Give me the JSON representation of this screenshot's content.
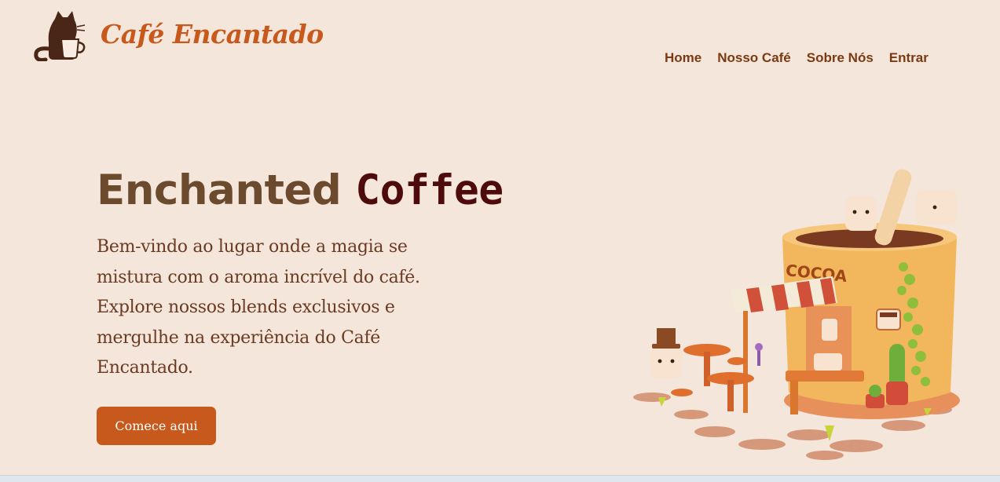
{
  "header": {
    "brand": "Café Encantado",
    "logo_icon": "cat-with-coffee-cup-icon"
  },
  "nav": {
    "items": [
      "Home",
      "Nosso Café",
      "Sobre Nós",
      "Entrar"
    ]
  },
  "hero": {
    "title_part1": "Enchanted",
    "title_part2": "Coffee",
    "description": "Bem-vindo ao lugar onde a magia se mistura com o aroma incrível do café. Explore nossos blends exclusivos e mergulhe na experiência do Café Encantado.",
    "cta_label": "Comece aqui",
    "illustration_sign": "COCOA",
    "illustration_icon": "coffee-shop-cup-illustration"
  },
  "colors": {
    "background": "#f5e6db",
    "brand": "#c8591c",
    "nav": "#7b3a12",
    "title_primary": "#6b4a2e",
    "title_accent": "#4e0b0b",
    "body_text": "#6b3a22"
  }
}
